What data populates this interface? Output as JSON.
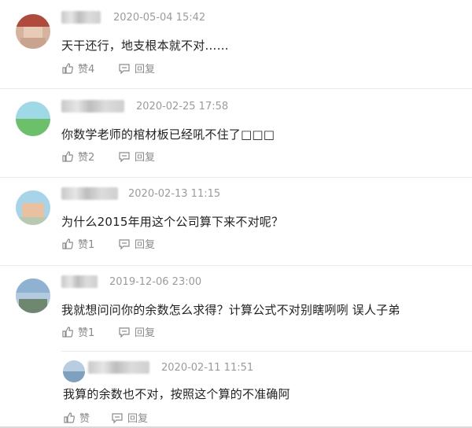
{
  "comments": [
    {
      "timestamp": "2020-05-04 15:42",
      "text": "天干还行，地支根本就不对……",
      "like_label": "赞4",
      "reply_label": "回复",
      "icons": {
        "like": "thumbs-up-icon",
        "reply": "comment-icon"
      }
    },
    {
      "timestamp": "2020-02-25 17:58",
      "text": "你数学老师的棺材板已经吼不住了□□□",
      "like_label": "赞2",
      "reply_label": "回复",
      "icons": {
        "like": "thumbs-up-icon",
        "reply": "comment-icon"
      }
    },
    {
      "timestamp": "2020-02-13 11:15",
      "text": "为什么2015年用这个公司算下来不对呢？",
      "like_label": "赞1",
      "reply_label": "回复",
      "icons": {
        "like": "thumbs-up-icon",
        "reply": "comment-icon"
      }
    },
    {
      "timestamp": "2019-12-06 23:00",
      "text": "我就想问问你的余数怎么求得？计算公式不对别瞎咧咧 误人子弟",
      "like_label": "赞1",
      "reply_label": "回复",
      "icons": {
        "like": "thumbs-up-icon",
        "reply": "comment-icon"
      }
    }
  ],
  "reply": {
    "timestamp": "2020-02-11 11:51",
    "text": "我算的余数也不对，按照这个算的不准确阿",
    "like_label": "赞",
    "reply_label": "回复",
    "icons": {
      "like": "thumbs-up-icon",
      "reply": "comment-icon"
    }
  },
  "colors": {
    "timestamp": "#9b9b9b",
    "text": "#222222",
    "action": "#8a8a8a",
    "divider": "#e9e9e9"
  }
}
